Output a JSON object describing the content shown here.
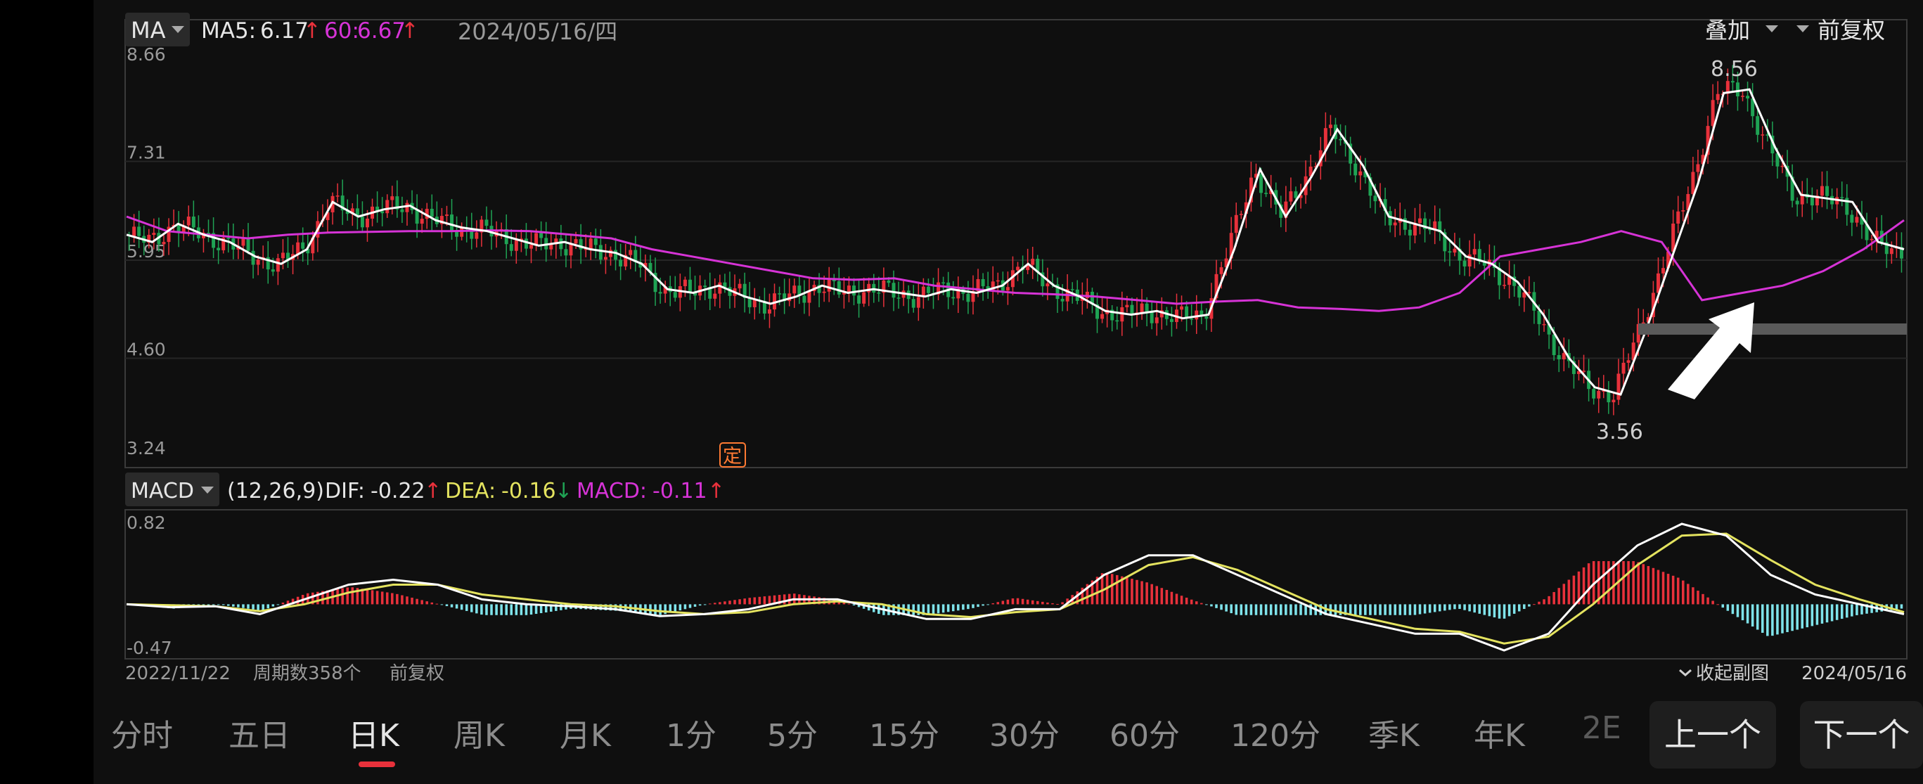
{
  "main_indicator": {
    "name": "MA",
    "ma5_label": "MA5:",
    "ma5_value": "6.17",
    "ma60_label": "60:",
    "ma60_value": "6.67",
    "date": "2024/05/16/四"
  },
  "top_right": {
    "overlay_label": "叠加",
    "adjust_label": "前复权"
  },
  "sub_indicator": {
    "name": "MACD",
    "params": "(12,26,9)",
    "dif_label": "DIF:",
    "dif_value": "-0.22",
    "dea_label": "DEA:",
    "dea_value": "-0.16",
    "macd_label": "MACD:",
    "macd_value": "-0.11"
  },
  "footer": {
    "start_date": "2022/11/22",
    "period_count": "周期数358个",
    "adjust": "前复权",
    "collapse": "收起副图",
    "end_date": "2024/05/16"
  },
  "tabs": [
    "分时",
    "五日",
    "日K",
    "周K",
    "月K",
    "1分",
    "5分",
    "15分",
    "30分",
    "60分",
    "120分",
    "季K",
    "年K",
    "2E"
  ],
  "active_tab": "日K",
  "nav": {
    "prev": "上一个",
    "next": "下一个"
  },
  "colors": {
    "up": "#e8313b",
    "down": "#1fa354",
    "ma5": "#ffffff",
    "ma60": "#d633d6",
    "dif": "#ffffff",
    "dea": "#e4e35f",
    "macd_neg": "#7fe3ea"
  },
  "chart_data": [
    {
      "type": "candlestick",
      "title": "",
      "y_ticks": [
        "8.66",
        "7.31",
        "5.95",
        "4.60",
        "3.24"
      ],
      "ylim": [
        3.24,
        8.66
      ],
      "x_range": [
        "2022/11/22",
        "2024/05/16"
      ],
      "period_count": 358,
      "annotations": {
        "high": "8.56",
        "low": "3.56",
        "badge": "定"
      },
      "series": [
        {
          "name": "MA5",
          "values": [
            6.3,
            6.2,
            6.45,
            6.3,
            6.2,
            6.0,
            5.9,
            6.1,
            6.75,
            6.55,
            6.65,
            6.7,
            6.5,
            6.4,
            6.35,
            6.25,
            6.15,
            6.2,
            6.1,
            6.05,
            5.9,
            5.55,
            5.5,
            5.6,
            5.45,
            5.35,
            5.45,
            5.6,
            5.5,
            5.55,
            5.5,
            5.45,
            5.55,
            5.5,
            5.6,
            5.9,
            5.6,
            5.45,
            5.25,
            5.2,
            5.25,
            5.15,
            5.2,
            6.1,
            7.2,
            6.55,
            7.1,
            7.75,
            7.25,
            6.55,
            6.45,
            6.35,
            6.0,
            5.9,
            5.65,
            5.2,
            4.6,
            4.2,
            4.1,
            5.0,
            6.0,
            7.0,
            8.25,
            8.3,
            7.5,
            6.85,
            6.8,
            6.75,
            6.2,
            6.1
          ]
        },
        {
          "name": "MA60",
          "values": [
            6.55,
            6.35,
            6.3,
            6.25,
            6.3,
            6.33,
            6.34,
            6.35,
            6.35,
            6.36,
            6.35,
            6.3,
            6.25,
            6.1,
            6.0,
            5.9,
            5.8,
            5.7,
            5.68,
            5.7,
            5.6,
            5.55,
            5.5,
            5.48,
            5.45,
            5.4,
            5.35,
            5.38,
            5.4,
            5.3,
            5.28,
            5.25,
            5.3,
            5.5,
            6.0,
            6.1,
            6.2,
            6.35,
            6.2,
            5.4,
            5.5,
            5.6,
            5.8,
            6.1,
            6.5
          ]
        }
      ]
    },
    {
      "type": "macd",
      "y_ticks": [
        "0.82",
        "-0.47"
      ],
      "ylim": [
        -0.47,
        0.82
      ],
      "series": [
        {
          "name": "DIF",
          "values": [
            0.0,
            -0.03,
            -0.02,
            -0.1,
            0.05,
            0.2,
            0.25,
            0.2,
            0.05,
            0.0,
            -0.02,
            -0.05,
            -0.12,
            -0.1,
            -0.05,
            0.05,
            0.05,
            -0.05,
            -0.15,
            -0.15,
            -0.05,
            -0.05,
            0.3,
            0.5,
            0.5,
            0.3,
            0.1,
            -0.1,
            -0.2,
            -0.3,
            -0.3,
            -0.47,
            -0.3,
            0.2,
            0.6,
            0.82,
            0.7,
            0.3,
            0.1,
            0.0,
            -0.1
          ]
        },
        {
          "name": "DEA",
          "values": [
            0.0,
            -0.01,
            -0.02,
            -0.07,
            0.0,
            0.12,
            0.2,
            0.2,
            0.1,
            0.05,
            0.0,
            -0.02,
            -0.07,
            -0.1,
            -0.08,
            0.0,
            0.03,
            0.0,
            -0.1,
            -0.13,
            -0.08,
            -0.05,
            0.15,
            0.4,
            0.48,
            0.35,
            0.15,
            -0.05,
            -0.15,
            -0.25,
            -0.28,
            -0.4,
            -0.33,
            0.0,
            0.4,
            0.7,
            0.72,
            0.45,
            0.2,
            0.05,
            -0.08
          ]
        }
      ]
    }
  ]
}
